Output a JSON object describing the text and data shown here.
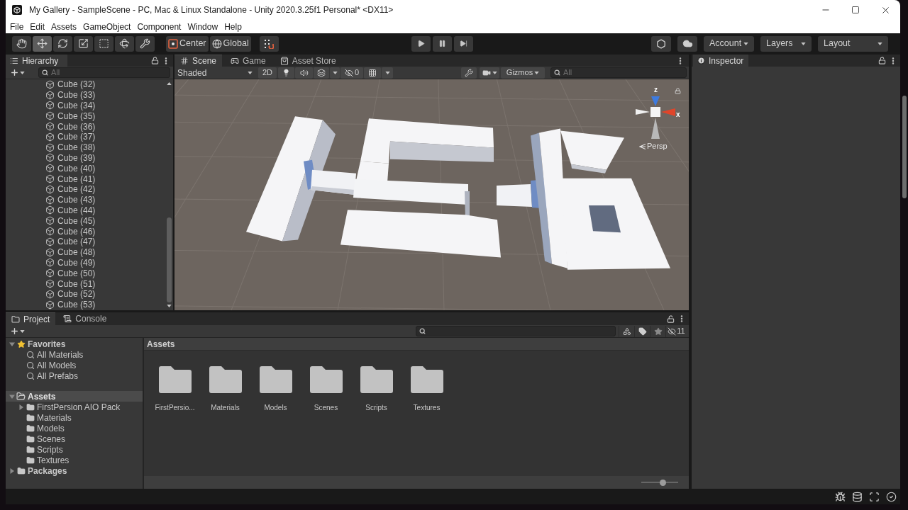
{
  "window": {
    "title": "My Gallery - SampleScene - PC, Mac & Linux Standalone - Unity 2020.3.25f1 Personal* <DX11>"
  },
  "menu": [
    "File",
    "Edit",
    "Assets",
    "GameObject",
    "Component",
    "Window",
    "Help"
  ],
  "toolbar": {
    "tools": [
      {
        "kind": "hand",
        "selected": false
      },
      {
        "kind": "move",
        "selected": true
      },
      {
        "kind": "rotate",
        "selected": false
      },
      {
        "kind": "scale",
        "selected": false
      },
      {
        "kind": "rect",
        "selected": false
      },
      {
        "kind": "transform",
        "selected": false
      },
      {
        "kind": "custom",
        "selected": false
      }
    ],
    "pivot": "Center",
    "space": "Global",
    "playback": [
      {
        "kind": "play"
      },
      {
        "kind": "pause"
      },
      {
        "kind": "step"
      }
    ],
    "account": "Account",
    "layers": "Layers",
    "layout": "Layout"
  },
  "hierarchy": {
    "title": "Hierarchy",
    "search_placeholder": "All",
    "items": [
      "Cube (32)",
      "Cube (33)",
      "Cube (34)",
      "Cube (35)",
      "Cube (36)",
      "Cube (37)",
      "Cube (38)",
      "Cube (39)",
      "Cube (40)",
      "Cube (41)",
      "Cube (42)",
      "Cube (43)",
      "Cube (44)",
      "Cube (45)",
      "Cube (46)",
      "Cube (47)",
      "Cube (48)",
      "Cube (49)",
      "Cube (50)",
      "Cube (51)",
      "Cube (52)",
      "Cube (53)"
    ]
  },
  "scene": {
    "tabs": [
      {
        "kind": "scene",
        "label": "Scene",
        "selected": true
      },
      {
        "kind": "game",
        "label": "Game",
        "selected": false
      },
      {
        "kind": "store",
        "label": "Asset Store",
        "selected": false
      }
    ],
    "shading": "Shaded",
    "view_2d": "2D",
    "hidden_count": "0",
    "gizmos": "Gizmos",
    "search_placeholder": "All",
    "axes": [
      "z",
      "x"
    ],
    "projection": "Persp"
  },
  "inspector": {
    "title": "Inspector"
  },
  "project": {
    "tabs": [
      {
        "kind": "project",
        "label": "Project",
        "selected": true
      },
      {
        "kind": "console",
        "label": "Console",
        "selected": false
      }
    ],
    "hidden_count": "11",
    "tree": [
      {
        "kind": "favorites",
        "label": "Favorites",
        "expanded": true,
        "selected": false,
        "children": [
          {
            "kind": "search",
            "label": "All Materials",
            "selected": false
          },
          {
            "kind": "search",
            "label": "All Models",
            "selected": false
          },
          {
            "kind": "search",
            "label": "All Prefabs",
            "selected": false
          }
        ]
      },
      {
        "kind": "folder",
        "label": "Assets",
        "expanded": true,
        "selected": true,
        "children": [
          {
            "kind": "folder",
            "label": "FirstPersion AIO Pack",
            "expanded": false,
            "selected": false
          },
          {
            "kind": "folder",
            "label": "Materials",
            "selected": false
          },
          {
            "kind": "folder",
            "label": "Models",
            "selected": false
          },
          {
            "kind": "folder",
            "label": "Scenes",
            "selected": false
          },
          {
            "kind": "folder",
            "label": "Scripts",
            "selected": false
          },
          {
            "kind": "folder",
            "label": "Textures",
            "selected": false
          }
        ]
      },
      {
        "kind": "folder",
        "label": "Packages",
        "expanded": false,
        "selected": false
      }
    ],
    "path": "Assets",
    "items": [
      "FirstPersio...",
      "Materials",
      "Models",
      "Scenes",
      "Scripts",
      "Textures"
    ],
    "zoom_slider": {
      "level": 0.58
    }
  }
}
